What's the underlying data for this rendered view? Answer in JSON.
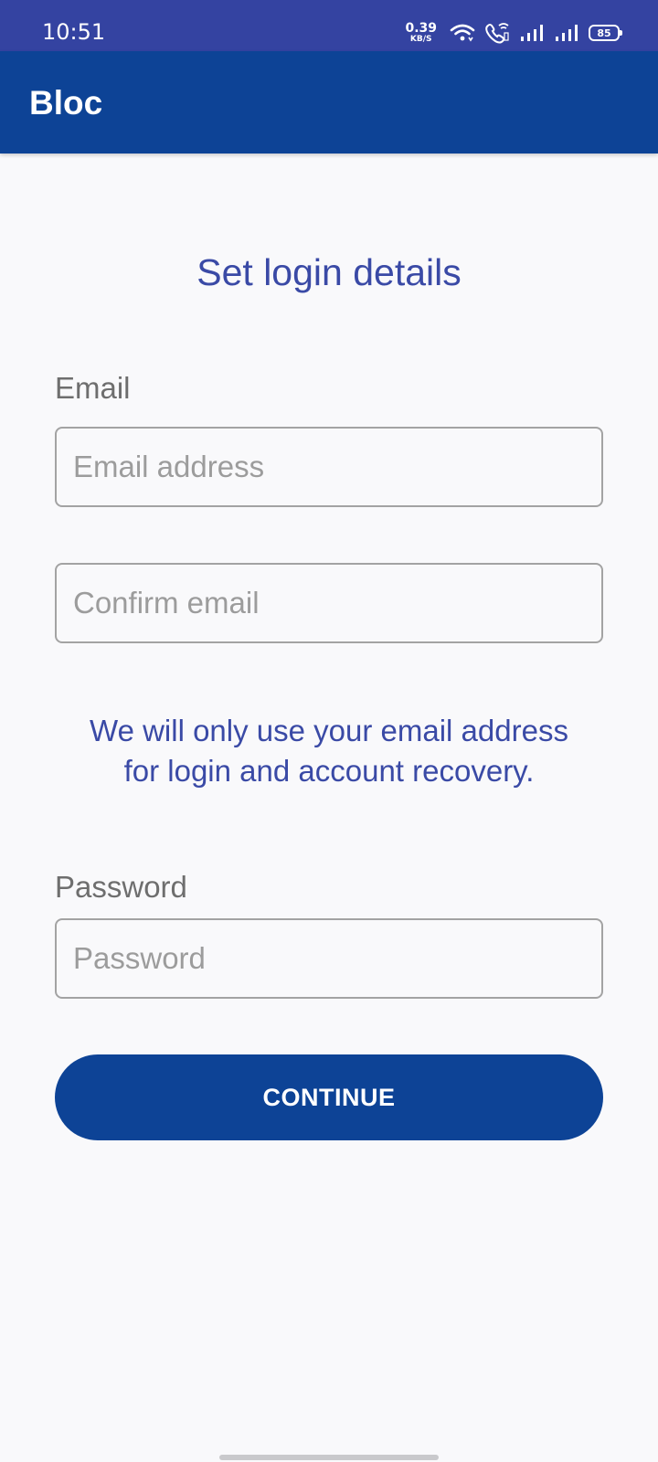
{
  "status_bar": {
    "time": "10:51",
    "net_speed_value": "0.39",
    "net_speed_unit": "KB/S",
    "battery": "85",
    "icons": [
      "wifi-icon",
      "wifi-call-icon",
      "signal-icon",
      "signal-icon",
      "battery-icon"
    ]
  },
  "app_bar": {
    "title": "Bloc"
  },
  "main": {
    "title": "Set login details",
    "email_label": "Email",
    "email_placeholder": "Email address",
    "confirm_email_placeholder": "Confirm email",
    "info_line_1": "We will only use your email address",
    "info_line_2": "for login and account recovery.",
    "password_label": "Password",
    "password_placeholder": "Password",
    "continue_label": "CONTINUE"
  },
  "colors": {
    "status_bar": "#3443a1",
    "app_bar": "#0d4396",
    "accent_text": "#3a4aa6",
    "button": "#0d4396",
    "background": "#f9f9fb"
  }
}
